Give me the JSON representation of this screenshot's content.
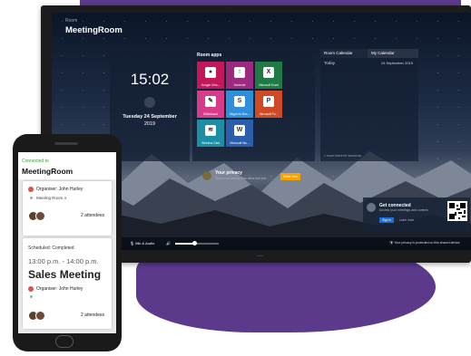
{
  "tv": {
    "brand": "Room",
    "title": "MeetingRoom",
    "logo": "~~~",
    "clock": {
      "time": "15:02",
      "date": "Tuesday 24 September",
      "year": "2019"
    },
    "room_apps": {
      "title": "Room apps",
      "tiles": [
        {
          "label": "Google Chro...",
          "icon": "chrome-icon",
          "glyph": "●",
          "bg": "#c2185b"
        },
        {
          "label": "Screenet",
          "icon": "screen-share-icon",
          "glyph": "↑",
          "bg": "#9c2a7e"
        },
        {
          "label": "Microsoft Excel",
          "icon": "excel-icon",
          "glyph": "X",
          "bg": "#1f7a45"
        },
        {
          "label": "Whiteboard",
          "icon": "whiteboard-icon",
          "glyph": "✎",
          "bg": "#d63c8a"
        },
        {
          "label": "Skype for Bus...",
          "icon": "skype-icon",
          "glyph": "S",
          "bg": "#2f8fd8"
        },
        {
          "label": "Microsoft Po...",
          "icon": "powerpoint-icon",
          "glyph": "P",
          "bg": "#d04a23"
        },
        {
          "label": "Wireless Cast",
          "icon": "wireless-cast-icon",
          "glyph": "≋",
          "bg": "#1b8fa6"
        },
        {
          "label": "Microsoft Wo...",
          "icon": "word-icon",
          "glyph": "W",
          "bg": "#2b5fad"
        }
      ]
    },
    "calendar": {
      "tab_room": "Room Calendar",
      "tab_my": "My Calendar",
      "today_label": "Today",
      "today_date": "24 September 2019",
      "footer": "1 more event for tomorrow"
    },
    "privacy": {
      "title": "Your privacy",
      "subtitle": "Clear in a nobody else sees this info",
      "button": "Clear now"
    },
    "connect": {
      "title": "Get connected",
      "subtitle": "Access your meetings and content",
      "signin": "Sign in",
      "learn": "Learn more"
    },
    "bottom_bar": {
      "mic": "Mic & Audio",
      "volume_level": 0.45,
      "privacy_note": "Your privacy is protected on this shared device"
    }
  },
  "phone": {
    "connected": "Connected to",
    "title": "MeetingRoom",
    "cards": [
      {
        "organizer": "Organiser: John Hurley",
        "room": "Meeting Room 4",
        "attendees": "2 attendees"
      },
      {
        "status": "Scheduled: Completed",
        "time": "13:00 p.m. - 14:00 p.m.",
        "title": "Sales Meeting",
        "organizer": "Organiser: John Hurley",
        "attendees": "2 attendees"
      }
    ]
  }
}
